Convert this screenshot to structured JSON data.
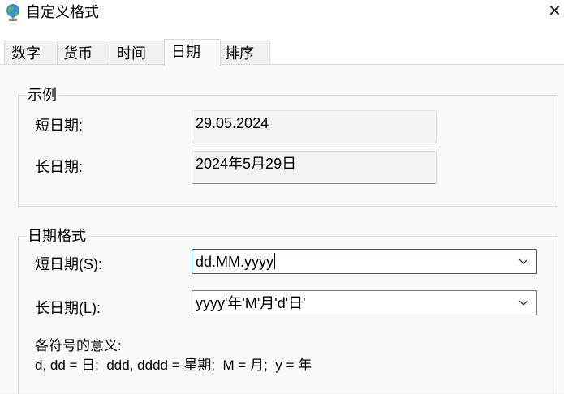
{
  "window": {
    "title": "自定义格式",
    "icon": "globe-icon",
    "close_glyph": "✕"
  },
  "tabs": [
    {
      "label": "数字",
      "active": false
    },
    {
      "label": "货币",
      "active": false
    },
    {
      "label": "时间",
      "active": false
    },
    {
      "label": "日期",
      "active": true
    },
    {
      "label": "排序",
      "active": false
    }
  ],
  "example": {
    "group_label": "示例",
    "short_label": "短日期:",
    "short_value": "29.05.2024",
    "long_label": "长日期:",
    "long_value": "2024年5月29日"
  },
  "format": {
    "group_label": "日期格式",
    "short_label": "短日期(S):",
    "short_value": "dd.MM.yyyy",
    "long_label": "长日期(L):",
    "long_value": "yyyy'年'M'月'd'日'",
    "legend_title": "各符号的意义:",
    "legend_text": "d, dd = 日;  ddd, dddd = 星期;  M = 月;  y = 年"
  },
  "colors": {
    "accent": "#0067c0",
    "panel_bg": "#f9f9f9",
    "window_bg": "#ffffff"
  }
}
